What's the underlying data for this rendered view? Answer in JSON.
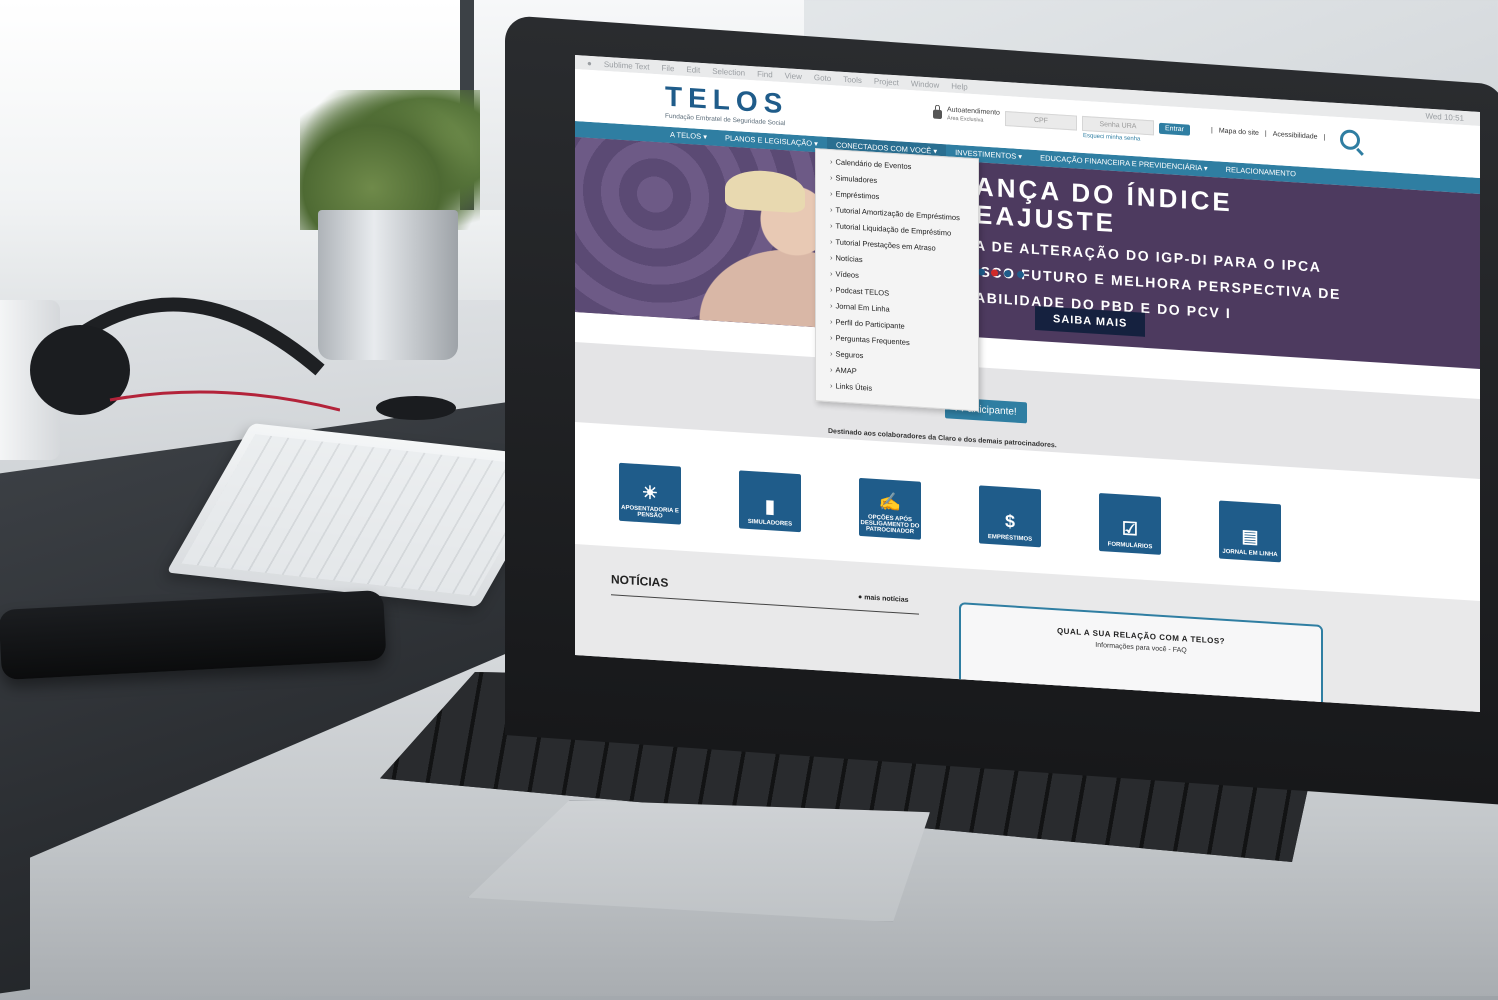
{
  "menubar": {
    "app": "Sublime Text",
    "items": [
      "File",
      "Edit",
      "Selection",
      "Find",
      "View",
      "Goto",
      "Tools",
      "Project",
      "Window",
      "Help"
    ],
    "clock": "Wed 10:51"
  },
  "header": {
    "logo": "TELOS",
    "tagline": "Fundação Embratel de Seguridade Social",
    "autoatendimento": "Autoatendimento",
    "area_exclusiva": "Área Exclusiva",
    "cpf_placeholder": "CPF",
    "senha_placeholder": "Senha URA",
    "entrar": "Entrar",
    "esqueci": "Esqueci minha senha",
    "mapa": "Mapa do site",
    "acessibilidade": "Acessibilidade"
  },
  "nav": [
    "A TELOS ▾",
    "PLANOS E LEGISLAÇÃO ▾",
    "CONECTADOS COM VOCÊ ▾",
    "INVESTIMENTOS ▾",
    "EDUCAÇÃO FINANCEIRA E PREVIDENCIÁRIA ▾",
    "RELACIONAMENTO"
  ],
  "dropdown": [
    "Calendário de Eventos",
    "Simuladores",
    "Empréstimos",
    "Tutorial Amortização de Empréstimos",
    "Tutorial Liquidação de Empréstimo",
    "Tutorial Prestações em Atraso",
    "Notícias",
    "Vídeos",
    "Podcast TELOS",
    "Jornal Em Linha",
    "Perfil do Participante",
    "Perguntas Frequentes",
    "Seguros",
    "AMAP",
    "Links Úteis"
  ],
  "hero": {
    "title_1": "ANÇA DO ÍNDICE",
    "title_2": "EAJUSTE",
    "sub_1": "A DE ALTERAÇÃO DO IGP-DI PARA O IPCA",
    "sub_2": "ISCO FUTURO E MELHORA PERSPECTIVA DE",
    "sub_3": "ABILIDADE DO PBD E DO PCV I",
    "cta": "SAIBA MAIS"
  },
  "participant": {
    "button": "r Participante!",
    "destinado": "Destinado aos colaboradores da Claro e dos demais patrocinadores."
  },
  "tiles": [
    {
      "label": "APOSENTADORIA E PENSÃO",
      "icon": "sun-waves-icon",
      "glyph": "☀"
    },
    {
      "label": "SIMULADORES",
      "icon": "bar-chart-icon",
      "glyph": "▮"
    },
    {
      "label": "OPÇÕES APÓS DESLIGAMENTO DO PATROCINADOR",
      "icon": "hand-pen-icon",
      "glyph": "✍"
    },
    {
      "label": "EMPRÉSTIMOS",
      "icon": "dollar-icon",
      "glyph": "$"
    },
    {
      "label": "FORMULÁRIOS",
      "icon": "checklist-icon",
      "glyph": "☑"
    },
    {
      "label": "JORNAL EM LINHA",
      "icon": "newspaper-icon",
      "glyph": "▤"
    }
  ],
  "news": {
    "title": "NOTÍCIAS",
    "more": "mais notícias",
    "relation_q": "QUAL A SUA RELAÇÃO COM A TELOS?",
    "relation_a": "Informações para você - FAQ"
  },
  "colors": {
    "brand": "#2f7ea2",
    "dark_blue": "#1f5c8a",
    "hero_bg": "#4d3a5f"
  }
}
